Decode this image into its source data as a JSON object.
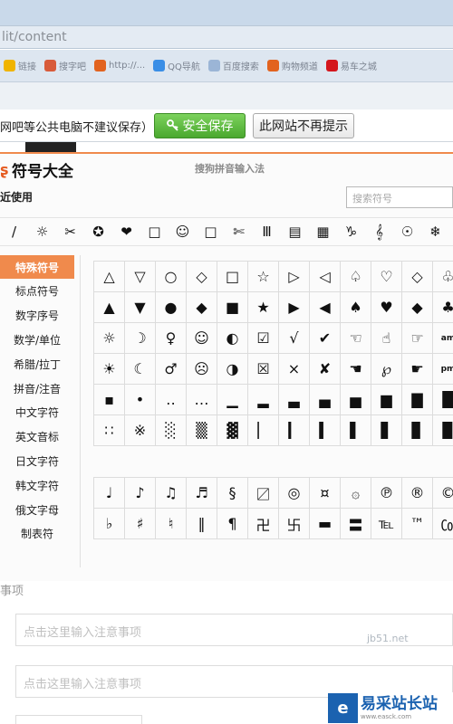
{
  "browser": {
    "url": "lit/content",
    "bookmarks": [
      {
        "label": "链接",
        "icon": "folder-icon",
        "color": "#f0b400"
      },
      {
        "label": "搜字吧",
        "icon": "people-icon",
        "color": "#d85b3a"
      },
      {
        "label": "http://...",
        "icon": "balloon-icon",
        "color": "#e2631f"
      },
      {
        "label": "QQ导航",
        "icon": "qq-icon",
        "color": "#3a8ee6"
      },
      {
        "label": "百度搜索",
        "icon": "page-icon",
        "color": "#9bb5d6"
      },
      {
        "label": "购物频道",
        "icon": "balloon-icon",
        "color": "#e2631f"
      },
      {
        "label": "易车之城",
        "icon": "le-icon",
        "color": "#d4161c"
      }
    ]
  },
  "save_bar": {
    "message": "网吧等公共电脑不建议保存）",
    "save_label": "安全保存",
    "never_label": "此网站不再提示"
  },
  "panel": {
    "title": "符号大全",
    "subtitle": "搜狗拼音输入法",
    "recent_label": "近使用",
    "search_placeholder": "搜索符号",
    "recent_symbols": [
      "/",
      "☼",
      "✂",
      "✪",
      "❤",
      "□",
      "☺",
      "□",
      "✄",
      "Ⅲ",
      "▤",
      "▦",
      "♑",
      "𝄞",
      "☉",
      "❄",
      "☸"
    ],
    "categories": [
      "特殊符号",
      "标点符号",
      "数字序号",
      "数学/单位",
      "希腊/拉丁",
      "拼音/注音",
      "中文字符",
      "英文音标",
      "日文字符",
      "韩文字符",
      "俄文字母",
      "制表符"
    ],
    "active_category": 0,
    "grid_top": [
      [
        "△",
        "▽",
        "○",
        "◇",
        "□",
        "☆",
        "▷",
        "◁",
        "♤",
        "♡",
        "◇",
        "♧"
      ],
      [
        "▲",
        "▼",
        "●",
        "◆",
        "■",
        "★",
        "▶",
        "◀",
        "♠",
        "♥",
        "◆",
        "♣"
      ],
      [
        "☼",
        "☽",
        "♀",
        "☺",
        "◐",
        "☑",
        "√",
        "✔",
        "☜",
        "☝",
        "☞",
        "am"
      ],
      [
        "☀",
        "☾",
        "♂",
        "☹",
        "◑",
        "☒",
        "×",
        "✘",
        "☚",
        "℘",
        "☛",
        "pm"
      ],
      [
        "▪",
        "•",
        "‥",
        "…",
        "▁",
        "▂",
        "▃",
        "▄",
        "▅",
        "▆",
        "▇",
        "█"
      ],
      [
        "∷",
        "※",
        "░",
        "▒",
        "▓",
        "▏",
        "▎",
        "▍",
        "▌",
        "▋",
        "▊",
        "▉"
      ]
    ],
    "grid_bottom": [
      [
        "♩",
        "♪",
        "♫",
        "♬",
        "§",
        "〼",
        "◎",
        "¤",
        "۞",
        "℗",
        "®",
        "©"
      ],
      [
        "♭",
        "♯",
        "♮",
        "‖",
        "¶",
        "卍",
        "卐",
        "▬",
        "〓",
        "℡",
        "™",
        "㏇"
      ]
    ]
  },
  "form": {
    "section_label": "事项",
    "field1_placeholder": "点击这里输入注意事项",
    "field2_placeholder": "点击这里输入注意事项",
    "faint_text": "jb51.net"
  },
  "watermark": {
    "badge": "e",
    "name": "易采站长站",
    "url": "www.easck.com"
  }
}
